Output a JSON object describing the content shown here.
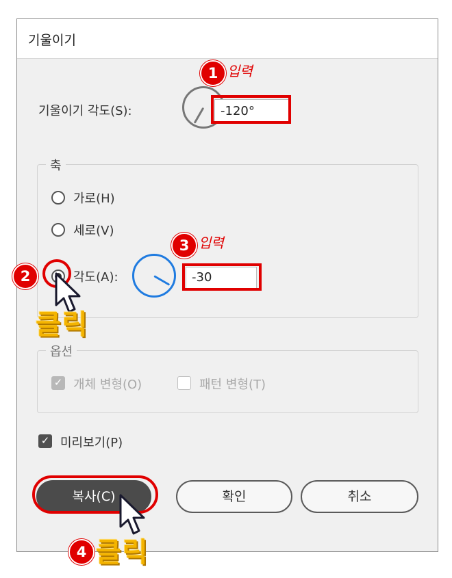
{
  "dialog": {
    "title": "기울이기",
    "shear_angle": {
      "label": "기울이기 각도(S):",
      "value": "-120°"
    },
    "axis": {
      "legend": "축",
      "horizontal": "가로(H)",
      "vertical": "세로(V)",
      "angle_label": "각도(A):",
      "angle_value": "-30",
      "selected": "angle"
    },
    "options": {
      "legend": "옵션",
      "transform_objects": "개체 변형(O)",
      "transform_patterns": "패턴 변형(T)"
    },
    "preview": "미리보기(P)",
    "buttons": {
      "copy": "복사(C)",
      "ok": "확인",
      "cancel": "취소"
    }
  },
  "annotations": {
    "step1": "1",
    "step1_text": "입력",
    "step2": "2",
    "step3": "3",
    "step3_text": "입력",
    "step4": "4",
    "click_text": "클릭",
    "highlight_color": "#e00000",
    "click_color": "#f4b400"
  }
}
